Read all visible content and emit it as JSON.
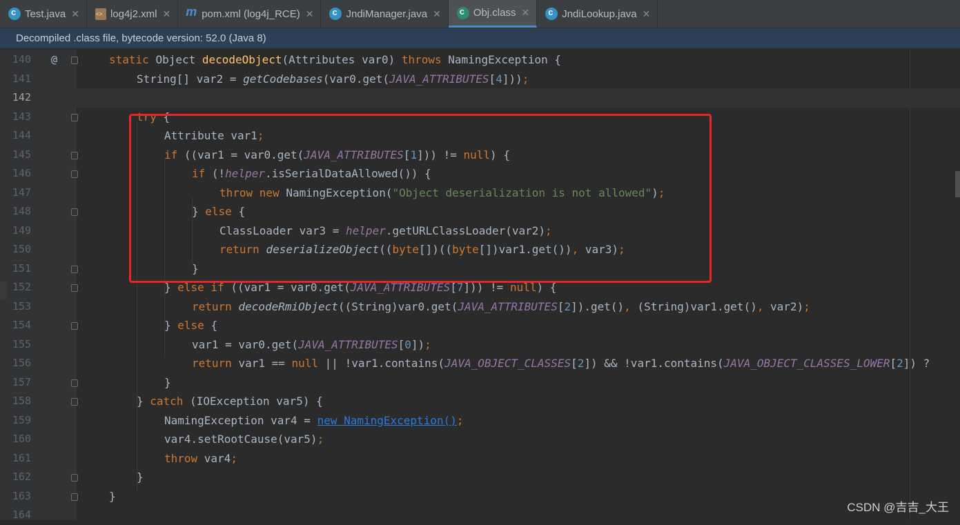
{
  "tabs": [
    {
      "label": "Test.java",
      "icon": "java-class-icon",
      "active": false
    },
    {
      "label": "log4j2.xml",
      "icon": "xml-file-icon",
      "active": false
    },
    {
      "label": "pom.xml (log4j_RCE)",
      "icon": "maven-icon",
      "active": false
    },
    {
      "label": "JndiManager.java",
      "icon": "java-class-icon",
      "active": false
    },
    {
      "label": "Obj.class",
      "icon": "class-file-icon",
      "active": true
    },
    {
      "label": "JndiLookup.java",
      "icon": "java-class-icon",
      "active": false
    }
  ],
  "banner": "Decompiled .class file, bytecode version: 52.0 (Java 8)",
  "watermark": "CSDN @吉吉_大王",
  "current_line": "142",
  "lines": [
    {
      "num": "140",
      "gutter": "@",
      "code": [
        [
          "kw",
          "static "
        ],
        [
          "",
          "Object "
        ],
        [
          "fn",
          "decodeObject"
        ],
        [
          "",
          "(Attributes var0) "
        ],
        [
          "kw",
          "throws "
        ],
        [
          "",
          "NamingException {"
        ]
      ]
    },
    {
      "num": "141",
      "code": [
        [
          "",
          "String[] var2 = "
        ],
        [
          "ital",
          "getCodebases"
        ],
        [
          "",
          "(var0.get("
        ],
        [
          "const",
          "JAVA_ATTRIBUTES"
        ],
        [
          "",
          "["
        ],
        [
          "num",
          "4"
        ],
        [
          "",
          "]))"
        ],
        [
          "kw",
          ";"
        ]
      ]
    },
    {
      "num": "142",
      "code": []
    },
    {
      "num": "143",
      "code": [
        [
          "kw",
          "try "
        ],
        [
          "",
          "{"
        ]
      ]
    },
    {
      "num": "144",
      "code": [
        [
          "",
          "Attribute var1"
        ],
        [
          "kw",
          ";"
        ]
      ]
    },
    {
      "num": "145",
      "code": [
        [
          "kw",
          "if "
        ],
        [
          "",
          "((var1 = var0.get("
        ],
        [
          "const",
          "JAVA_ATTRIBUTES"
        ],
        [
          "",
          "["
        ],
        [
          "num",
          "1"
        ],
        [
          "",
          "])) != "
        ],
        [
          "kw",
          "null"
        ],
        [
          "",
          ") {"
        ]
      ]
    },
    {
      "num": "146",
      "code": [
        [
          "kw",
          "if "
        ],
        [
          "",
          "(!"
        ],
        [
          "const",
          "helper"
        ],
        [
          "",
          ".isSerialDataAllowed()) {"
        ]
      ]
    },
    {
      "num": "147",
      "code": [
        [
          "kw",
          "throw new "
        ],
        [
          "",
          "NamingException("
        ],
        [
          "str",
          "\"Object deserialization is not allowed\""
        ],
        [
          "",
          ")"
        ],
        [
          "kw",
          ";"
        ]
      ]
    },
    {
      "num": "148",
      "code": [
        [
          "",
          "} "
        ],
        [
          "kw",
          "else "
        ],
        [
          "",
          "{"
        ]
      ]
    },
    {
      "num": "149",
      "code": [
        [
          "",
          "ClassLoader var3 = "
        ],
        [
          "const",
          "helper"
        ],
        [
          "",
          ".getURLClassLoader(var2)"
        ],
        [
          "kw",
          ";"
        ]
      ]
    },
    {
      "num": "150",
      "code": [
        [
          "kw",
          "return "
        ],
        [
          "ital",
          "deserializeObject"
        ],
        [
          "",
          "(("
        ],
        [
          "kw",
          "byte"
        ],
        [
          "",
          "[])(("
        ],
        [
          "kw",
          "byte"
        ],
        [
          "",
          "[])var1.get())"
        ],
        [
          "kw",
          ", "
        ],
        [
          "",
          "var3)"
        ],
        [
          "kw",
          ";"
        ]
      ]
    },
    {
      "num": "151",
      "code": [
        [
          "",
          "}"
        ]
      ]
    },
    {
      "num": "152",
      "code": [
        [
          "",
          "} "
        ],
        [
          "kw",
          "else if "
        ],
        [
          "",
          "((var1 = var0.get("
        ],
        [
          "const",
          "JAVA_ATTRIBUTES"
        ],
        [
          "",
          "["
        ],
        [
          "num",
          "7"
        ],
        [
          "",
          "])) != "
        ],
        [
          "kw",
          "null"
        ],
        [
          "",
          ") {"
        ]
      ]
    },
    {
      "num": "153",
      "code": [
        [
          "kw",
          "return "
        ],
        [
          "ital",
          "decodeRmiObject"
        ],
        [
          "",
          "((String)var0.get("
        ],
        [
          "const",
          "JAVA_ATTRIBUTES"
        ],
        [
          "",
          "["
        ],
        [
          "num",
          "2"
        ],
        [
          "",
          "]).get()"
        ],
        [
          "kw",
          ", "
        ],
        [
          "",
          "(String)var1.get()"
        ],
        [
          "kw",
          ", "
        ],
        [
          "",
          "var2)"
        ],
        [
          "kw",
          ";"
        ]
      ]
    },
    {
      "num": "154",
      "code": [
        [
          "",
          "} "
        ],
        [
          "kw",
          "else "
        ],
        [
          "",
          "{"
        ]
      ]
    },
    {
      "num": "155",
      "code": [
        [
          "",
          "var1 = var0.get("
        ],
        [
          "const",
          "JAVA_ATTRIBUTES"
        ],
        [
          "",
          "["
        ],
        [
          "num",
          "0"
        ],
        [
          "",
          "])"
        ],
        [
          "kw",
          ";"
        ]
      ]
    },
    {
      "num": "156",
      "code": [
        [
          "kw",
          "return "
        ],
        [
          "",
          "var1 == "
        ],
        [
          "kw",
          "null "
        ],
        [
          "",
          "|| !var1.contains("
        ],
        [
          "const",
          "JAVA_OBJECT_CLASSES"
        ],
        [
          "",
          "["
        ],
        [
          "num",
          "2"
        ],
        [
          "",
          "]) && !var1.contains("
        ],
        [
          "const",
          "JAVA_OBJECT_CLASSES_LOWER"
        ],
        [
          "",
          "["
        ],
        [
          "num",
          "2"
        ],
        [
          "",
          "]) ?"
        ]
      ]
    },
    {
      "num": "157",
      "code": [
        [
          "",
          "}"
        ]
      ]
    },
    {
      "num": "158",
      "code": [
        [
          "",
          "} "
        ],
        [
          "kw",
          "catch "
        ],
        [
          "",
          "(IOException var5) {"
        ]
      ]
    },
    {
      "num": "159",
      "code": [
        [
          "",
          "NamingException var4 = "
        ],
        [
          "link",
          "new NamingException()"
        ],
        [
          "kw",
          ";"
        ]
      ]
    },
    {
      "num": "160",
      "code": [
        [
          "",
          "var4.setRootCause(var5)"
        ],
        [
          "kw",
          ";"
        ]
      ]
    },
    {
      "num": "161",
      "code": [
        [
          "kw",
          "throw "
        ],
        [
          "",
          "var4"
        ],
        [
          "kw",
          ";"
        ]
      ]
    },
    {
      "num": "162",
      "code": [
        [
          "",
          "}"
        ]
      ]
    },
    {
      "num": "163",
      "code": [
        [
          "",
          "}"
        ]
      ]
    },
    {
      "num": "164",
      "code": []
    }
  ]
}
